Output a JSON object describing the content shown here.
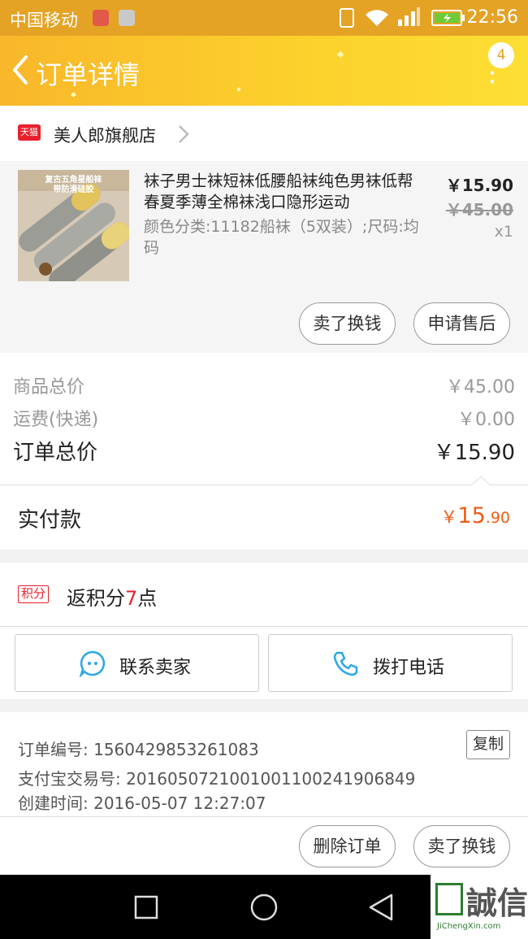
{
  "status_bar": {
    "carrier": "中国移动",
    "time": "22:56"
  },
  "header": {
    "title": "订单详情",
    "badge_count": "4"
  },
  "store": {
    "logo_text": "天猫",
    "name": "美人郎旗舰店"
  },
  "item": {
    "thumb_caption_1": "复古五角星船袜",
    "thumb_caption_2": "带防滑硅胶",
    "title": "袜子男士袜短袜低腰船袜纯色男袜低帮春夏季薄全棉袜浅口隐形运动",
    "sku": "颜色分类:11182船袜（5双装）;尺码:均码",
    "price": "￥15.90",
    "original_price": "￥45.00",
    "quantity": "x1",
    "btn_resell": "卖了换钱",
    "btn_after_sale": "申请售后"
  },
  "totals": {
    "goods_label": "商品总价",
    "goods_value": "￥45.00",
    "shipping_label": "运费(快递)",
    "shipping_value": "￥0.00",
    "order_label": "订单总价",
    "order_value": "￥15.90"
  },
  "paid": {
    "label": "实付款",
    "currency": "￥",
    "integer": "15",
    "decimal": ".90"
  },
  "points": {
    "tag": "积分",
    "prefix": "返积分",
    "value": "7",
    "suffix": "点"
  },
  "contact": {
    "seller_label": "联系卖家",
    "call_label": "拨打电话"
  },
  "order_info": {
    "order_no": "订单编号: 1560429853261083",
    "alipay_no": "支付宝交易号: 2016050721001001100241906849",
    "created": "创建时间: 2016-05-07 12:27:07",
    "copy_label": "复制"
  },
  "bottom_actions": {
    "delete_label": "删除订单",
    "resell_label": "卖了换钱"
  },
  "watermark": {
    "logo": "誠信",
    "url": "JiChengXin.com"
  },
  "colors": {
    "accent": "#f8b72a",
    "price_orange": "#f25c14",
    "tmall_red": "#e8202c"
  }
}
